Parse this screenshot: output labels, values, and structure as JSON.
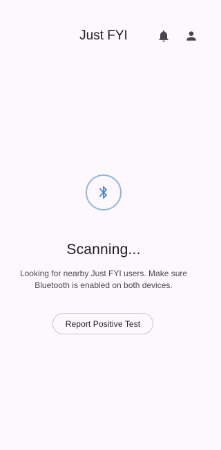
{
  "app_bar": {
    "title": "Just FYI",
    "icons": [
      "notifications-bell-icon",
      "account-person-icon"
    ]
  },
  "main": {
    "scan_icon": "bluetooth-icon",
    "status_title": "Scanning...",
    "status_description": "Looking for nearby Just FYI users. Make sure Bluetooth is enabled on both devices.",
    "report_button_label": "Report Positive Test"
  },
  "colors": {
    "background": "#fdf8fd",
    "accent_blue": "#4a86d4",
    "circle_border": "#8fb5e0",
    "text_primary": "#1c1b1f",
    "text_secondary": "#49454f",
    "button_outline": "#c9c4cf"
  }
}
